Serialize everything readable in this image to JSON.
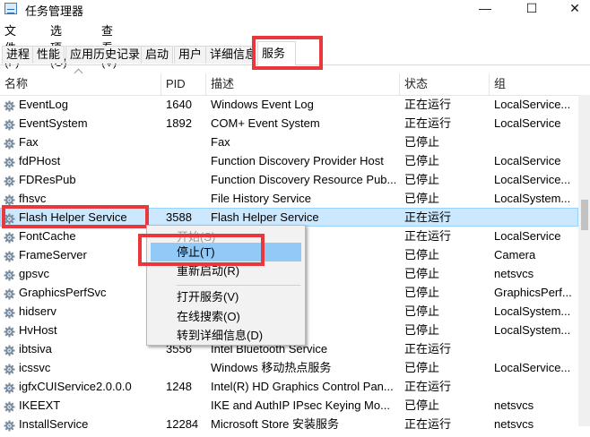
{
  "window": {
    "title": "任务管理器",
    "minimize_glyph": "—",
    "maximize_glyph": "☐",
    "close_glyph": "✕"
  },
  "menu": {
    "items": [
      "文件(F)",
      "选项(O)",
      "查看(V)"
    ]
  },
  "tabs": {
    "items": [
      "进程",
      "性能",
      "应用历史记录",
      "启动",
      "用户",
      "详细信息",
      "服务"
    ],
    "active": "服务"
  },
  "columns": {
    "name": "名称",
    "pid": "PID",
    "description": "描述",
    "status": "状态",
    "group": "组"
  },
  "rows": [
    {
      "name": "EventLog",
      "pid": "1640",
      "description": "Windows Event Log",
      "status": "正在运行",
      "group": "LocalService..."
    },
    {
      "name": "EventSystem",
      "pid": "1892",
      "description": "COM+ Event System",
      "status": "正在运行",
      "group": "LocalService"
    },
    {
      "name": "Fax",
      "pid": "",
      "description": "Fax",
      "status": "已停止",
      "group": ""
    },
    {
      "name": "fdPHost",
      "pid": "",
      "description": "Function Discovery Provider Host",
      "status": "已停止",
      "group": "LocalService"
    },
    {
      "name": "FDResPub",
      "pid": "",
      "description": "Function Discovery Resource Pub...",
      "status": "已停止",
      "group": "LocalService..."
    },
    {
      "name": "fhsvc",
      "pid": "",
      "description": "File History Service",
      "status": "已停止",
      "group": "LocalSystem..."
    },
    {
      "name": "Flash Helper Service",
      "pid": "3588",
      "description": "Flash Helper Service",
      "status": "正在运行",
      "group": ""
    },
    {
      "name": "FontCache",
      "pid": "",
      "description": "...che Service",
      "status": "正在运行",
      "group": "LocalService"
    },
    {
      "name": "FrameServer",
      "pid": "",
      "description": "...Frame Server",
      "status": "已停止",
      "group": "Camera"
    },
    {
      "name": "gpsvc",
      "pid": "",
      "description": "...t",
      "status": "已停止",
      "group": "netsvcs"
    },
    {
      "name": "GraphicsPerfSvc",
      "pid": "",
      "description": "",
      "status": "已停止",
      "group": "GraphicsPerf..."
    },
    {
      "name": "hidserv",
      "pid": "",
      "description": "...evice Service",
      "status": "已停止",
      "group": "LocalSystem..."
    },
    {
      "name": "HvHost",
      "pid": "",
      "description": "",
      "status": "已停止",
      "group": "LocalSystem..."
    },
    {
      "name": "ibtsiva",
      "pid": "3556",
      "description": "Intel Bluetooth Service",
      "status": "正在运行",
      "group": ""
    },
    {
      "name": "icssvc",
      "pid": "",
      "description": "Windows 移动热点服务",
      "status": "已停止",
      "group": "LocalService..."
    },
    {
      "name": "igfxCUIService2.0.0.0",
      "pid": "1248",
      "description": "Intel(R) HD Graphics Control Pan...",
      "status": "正在运行",
      "group": ""
    },
    {
      "name": "IKEEXT",
      "pid": "",
      "description": "IKE and AuthIP IPsec Keying Mo...",
      "status": "已停止",
      "group": "netsvcs"
    },
    {
      "name": "InstallService",
      "pid": "12284",
      "description": "Microsoft Store 安装服务",
      "status": "正在运行",
      "group": "netsvcs"
    }
  ],
  "context_menu": {
    "start": "开始(S)",
    "stop": "停止(T)",
    "restart": "重新启动(R)",
    "open_services": "打开服务(V)",
    "search_online": "在线搜索(O)",
    "go_to_details": "转到详细信息(D)"
  },
  "colors": {
    "highlight_border": "#e8383d",
    "selection": "#cce8ff",
    "menu_hover": "#91c9f7"
  }
}
